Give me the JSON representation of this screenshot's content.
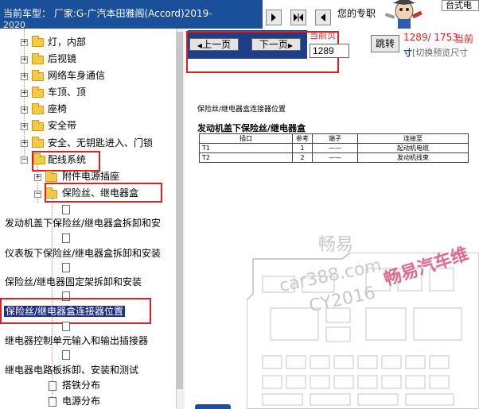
{
  "header": {
    "car_model_line1": "当前车型：  厂家:G-广汽本田雅阁(Accord)2019-",
    "car_model_line2": "2020",
    "mode_label": "您的专职",
    "brand_badge": "台式电"
  },
  "tree": {
    "items": [
      {
        "label": "灯，内部"
      },
      {
        "label": "后视镜"
      },
      {
        "label": "网络车身通信"
      },
      {
        "label": "车顶、顶"
      },
      {
        "label": "座椅"
      },
      {
        "label": "安全带"
      },
      {
        "label": "安全、无钥匙进入、门锁"
      },
      {
        "label": "配线系统"
      },
      {
        "label": "附件电源插座"
      },
      {
        "label": "保险丝、继电器盒"
      },
      {
        "label": "发动机盖下保险丝/继电器盒拆卸和安"
      },
      {
        "label": "仪表板下保险丝/继电器盒拆卸和安装"
      },
      {
        "label": "保险丝/继电器固定架拆卸和安装"
      },
      {
        "label": "保险丝/继电器盒连接器位置"
      },
      {
        "label": "继电器控制单元输入和输出插接器"
      },
      {
        "label": "继电器电路板拆卸、安装和测试"
      },
      {
        "label": "搭铁分布"
      },
      {
        "label": "电源分布"
      }
    ]
  },
  "pager": {
    "prev_label": "上一页",
    "next_label": "下一页",
    "current_label": "当前页",
    "page_value": "1289",
    "jump_label": "跳转",
    "page_count": "1289/ 1753",
    "current_label2": "当前",
    "preview_hint_prefix": "寸",
    "preview_hint": "[切换预览尺寸"
  },
  "document": {
    "heading": "保险丝/继电器盒连接器位置",
    "subtitle": "发动机盖下保险丝/继电器盒",
    "table_headers": [
      "插口",
      "参考",
      "端子",
      "连接至"
    ],
    "table_rows": [
      [
        "T1",
        "1",
        "——",
        "起动机电缆"
      ],
      [
        "T2",
        "2",
        "——",
        "发动机线束"
      ]
    ],
    "watermark_1": "畅易",
    "watermark_2": "car388.com",
    "watermark_3": "CY2016",
    "watermark_red": "畅易汽车维"
  },
  "colors": {
    "title_bar": "#1a4f9a",
    "nav_bar": "#1d3f8a",
    "highlight_red": "#e02020",
    "selected_bg": "#1f2f8c"
  }
}
